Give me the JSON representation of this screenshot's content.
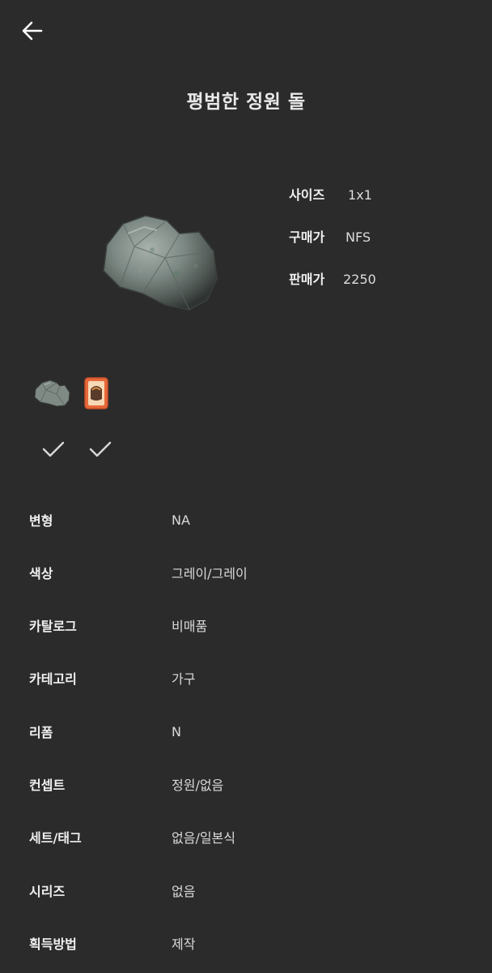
{
  "header": {
    "back_icon": "arrow-left-icon",
    "title": "평범한 정원 돌"
  },
  "item": {
    "image_icon": "garden-rock-image",
    "specs": [
      {
        "label": "사이즈",
        "value": "1x1"
      },
      {
        "label": "구매가",
        "value": "NFS"
      },
      {
        "label": "판매가",
        "value": "2250"
      }
    ]
  },
  "variants": {
    "thumbnails": [
      {
        "icon": "rock-thumbnail"
      },
      {
        "icon": "diy-recipe-card-icon"
      }
    ],
    "checks": [
      {
        "icon": "check-icon"
      },
      {
        "icon": "check-icon"
      }
    ]
  },
  "details": [
    {
      "label": "변형",
      "value": "NA"
    },
    {
      "label": "색상",
      "value": "그레이/그레이"
    },
    {
      "label": "카탈로그",
      "value": "비매품"
    },
    {
      "label": "카테고리",
      "value": "가구"
    },
    {
      "label": "리폼",
      "value": "N"
    },
    {
      "label": "컨셉트",
      "value": "정원/없음"
    },
    {
      "label": "세트/태그",
      "value": "없음/일본식"
    },
    {
      "label": "시리즈",
      "value": "없음"
    },
    {
      "label": "획득방법",
      "value": "제작"
    }
  ],
  "colors": {
    "background": "#2b2b2b",
    "text": "#e6e6e6",
    "card_accent": "#e8693a"
  }
}
